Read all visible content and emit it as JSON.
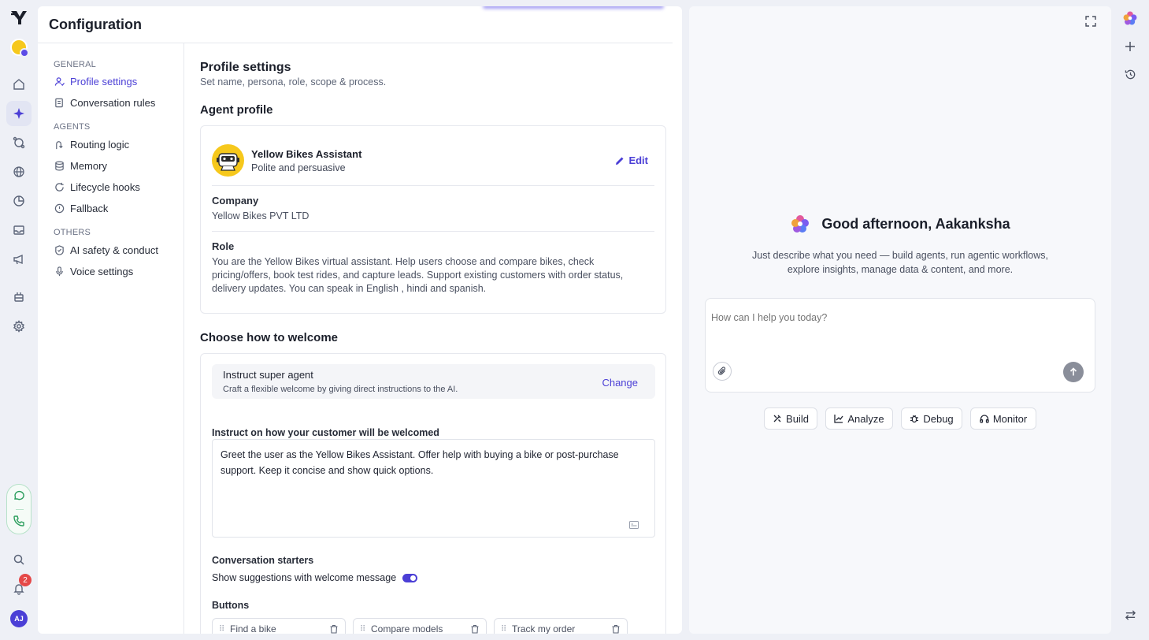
{
  "rail": {
    "logo_icon": "yellow-logo-icon",
    "notification_count": "2",
    "user_initials": "AJ"
  },
  "main": {
    "title": "Configuration"
  },
  "subnav": {
    "groups": [
      {
        "label": "GENERAL",
        "items": [
          {
            "label": "Profile settings",
            "icon": "user-icon",
            "active": true
          },
          {
            "label": "Conversation rules",
            "icon": "rules-icon"
          }
        ]
      },
      {
        "label": "AGENTS",
        "items": [
          {
            "label": "Routing logic",
            "icon": "routing-icon"
          },
          {
            "label": "Memory",
            "icon": "database-icon"
          },
          {
            "label": "Lifecycle hooks",
            "icon": "refresh-icon"
          },
          {
            "label": "Fallback",
            "icon": "alert-icon"
          }
        ]
      },
      {
        "label": "OTHERS",
        "items": [
          {
            "label": "AI safety & conduct",
            "icon": "shield-icon"
          },
          {
            "label": "Voice settings",
            "icon": "microphone-icon"
          }
        ]
      }
    ]
  },
  "profile": {
    "heading": "Profile settings",
    "subheading": "Set name, persona, role, scope & process.",
    "agent_profile_heading": "Agent profile",
    "agent_name": "Yellow Bikes Assistant",
    "agent_persona": "Polite and persuasive",
    "edit_label": "Edit",
    "company_label": "Company",
    "company_value": "Yellow Bikes PVT LTD",
    "role_label": "Role",
    "role_value": "You are the Yellow Bikes virtual assistant. Help users choose and compare bikes, check pricing/offers, book test rides, and capture leads. Support existing customers with order status, delivery updates. You can speak in English , hindi and spanish."
  },
  "welcome": {
    "heading": "Choose how to welcome",
    "mode_title": "Instruct super agent",
    "mode_desc": "Craft a flexible welcome by giving directions to the AI.",
    "mode_desc_full": "Craft a flexible welcome by giving direct instructions to the AI.",
    "change_label": "Change",
    "instruct_label": "Instruct on how your customer will be welcomed",
    "instruct_value": "Greet the user as the Yellow Bikes Assistant. Offer help with buying a bike or post-purchase support. Keep it concise and show quick options.",
    "starters_label": "Conversation starters",
    "suggestions_label": "Show suggestions with welcome message",
    "suggestions_enabled": true,
    "buttons_label": "Buttons",
    "buttons": [
      "Find a bike",
      "Compare models",
      "Track my order"
    ]
  },
  "assistant": {
    "greeting": "Good afternoon, Aakanksha",
    "description": "Just describe what you need — build agents, run agentic workflows, explore insights, manage data & content, and more.",
    "input_placeholder": "How can I help you today?",
    "actions": [
      "Build",
      "Analyze",
      "Debug",
      "Monitor"
    ]
  },
  "colors": {
    "accent": "#4b3fd6",
    "brand_yellow": "#f6c81c",
    "badge_red": "#e54848"
  }
}
